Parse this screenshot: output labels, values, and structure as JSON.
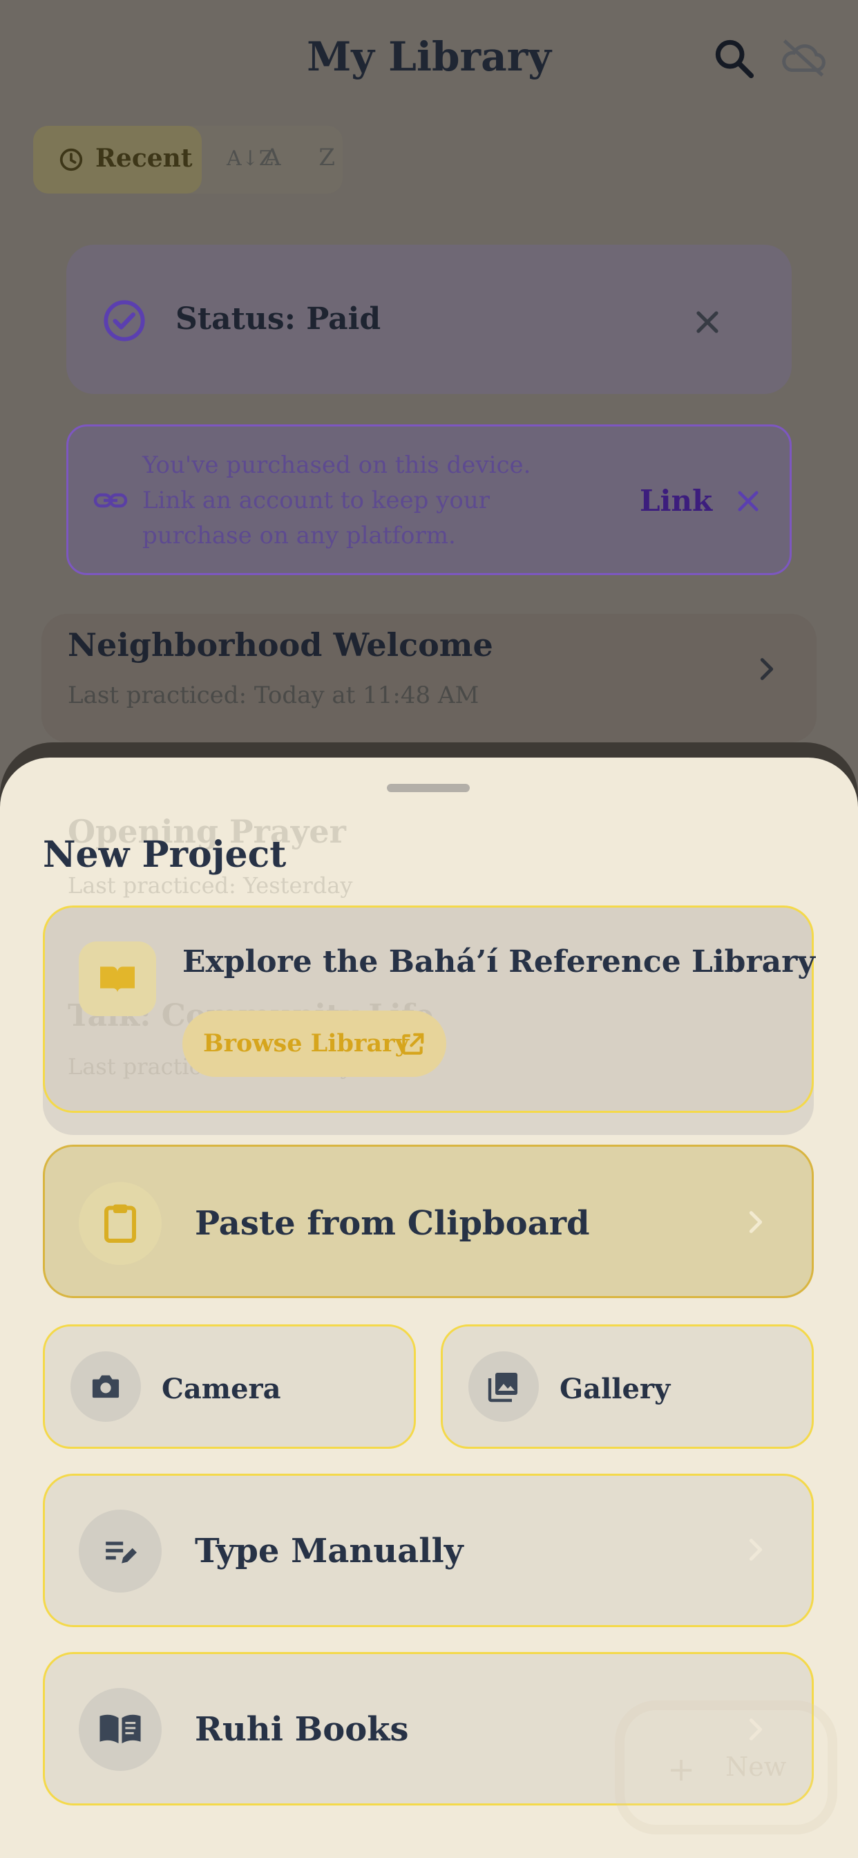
{
  "header": {
    "title": "My Library",
    "icons": [
      "search-icon",
      "cloud-off-icon"
    ]
  },
  "sort": {
    "recent_label": "Recent",
    "az_label": "A Z",
    "active": "Recent"
  },
  "status_banner": {
    "text": "Status: Paid"
  },
  "link_banner": {
    "text": "You've purchased on this device. Link an account to keep your purchase on any platform.",
    "action_label": "Link"
  },
  "library": {
    "items": [
      {
        "title": "Neighborhood Welcome",
        "subtitle": "Last practiced: Today at 11:48 AM"
      },
      {
        "title": "Opening Prayer",
        "subtitle": "Last practiced: Yesterday"
      },
      {
        "title": "Talk: Community Life",
        "subtitle": "Last practiced: Yesterday"
      }
    ]
  },
  "fab": {
    "label": "New",
    "icon": "plus-icon"
  },
  "sheet": {
    "title": "New Project",
    "explore": {
      "title": "Explore the Bahá’í Reference Library",
      "button_label": "Browse Library"
    },
    "options": {
      "clipboard": "Paste from Clipboard",
      "camera": "Camera",
      "gallery": "Gallery",
      "type": "Type Manually",
      "ruhi": "Ruhi Books"
    }
  },
  "colors": {
    "accent_yellow": "#f4d94a",
    "purple": "#7d57c1",
    "sheet_bg": "#f1ead9",
    "text_dark": "#273246"
  }
}
